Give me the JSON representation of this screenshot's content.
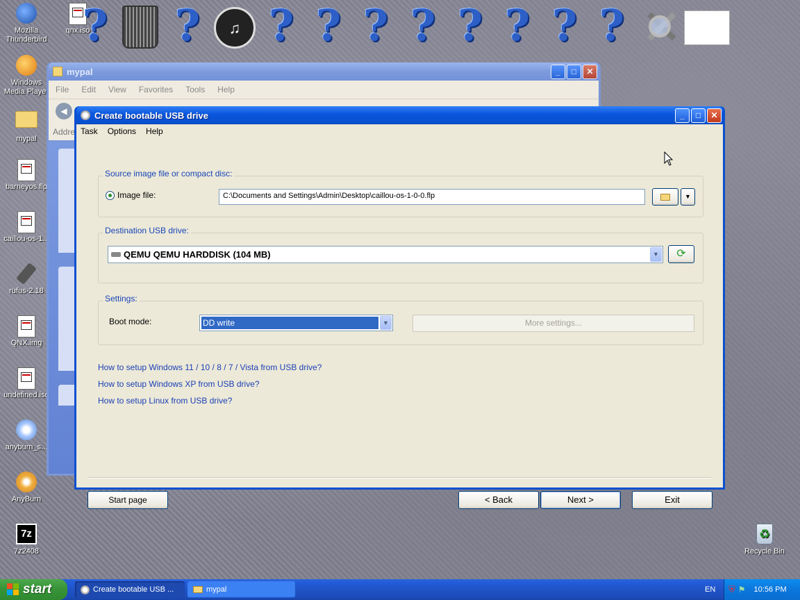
{
  "desktop": {
    "left_icons": [
      {
        "label": "Mozilla Thunderbird",
        "icon": "thunderbird-icon"
      },
      {
        "label": "Windows Media Player",
        "icon": "media-player-icon"
      },
      {
        "label": "mypal",
        "icon": "folder-icon"
      },
      {
        "label": "barneyos.flp",
        "icon": "disk-image-icon"
      },
      {
        "label": "caillou-os-1...",
        "icon": "disk-image-icon"
      },
      {
        "label": "rufus-2.18",
        "icon": "usb-icon"
      },
      {
        "label": "QNX.img",
        "icon": "disk-image-icon"
      },
      {
        "label": "undefined.iso",
        "icon": "disk-image-icon"
      },
      {
        "label": "anyburn_s...",
        "icon": "installer-icon"
      },
      {
        "label": "AnyBurn",
        "icon": "anyburn-icon"
      },
      {
        "label": "7z2408",
        "icon": "7zip-icon"
      }
    ],
    "second_col": [
      {
        "label": "qnx.iso",
        "icon": "disk-image-icon"
      }
    ],
    "recycle_bin": "Recycle Bin",
    "question_mark": "?"
  },
  "mypal_window": {
    "title": "mypal",
    "menu": [
      "File",
      "Edit",
      "View",
      "Favorites",
      "Tools",
      "Help"
    ],
    "address_label": "Addres"
  },
  "main_window": {
    "title": "Create bootable USB drive",
    "menu": [
      "Task",
      "Options",
      "Help"
    ],
    "source": {
      "group_label": "Source image file or compact disc:",
      "radio_label": "Image file:",
      "path": "C:\\Documents and Settings\\Admin\\Desktop\\caillou-os-1-0-0.flp"
    },
    "destination": {
      "group_label": "Destination USB drive:",
      "drive": "QEMU QEMU HARDDISK (104 MB)"
    },
    "settings": {
      "group_label": "Settings:",
      "boot_mode_label": "Boot mode:",
      "boot_mode_value": "DD write",
      "more_settings": "More settings..."
    },
    "links": [
      "How to setup Windows 11 / 10 / 8 / 7 / Vista from USB drive?",
      "How to setup Windows XP from USB drive?",
      "How to setup Linux from USB drive?"
    ],
    "buttons": {
      "start_page": "Start page",
      "back": "< Back",
      "next": "Next >",
      "exit": "Exit"
    }
  },
  "taskbar": {
    "start_label": "start",
    "tasks": [
      {
        "label": "Create bootable USB ...",
        "active": true
      },
      {
        "label": "mypal",
        "active": false
      }
    ],
    "language": "EN",
    "clock": "10:56 PM"
  },
  "colors": {
    "title_blue": "#0a55dc",
    "dialog_bg": "#ece9d8",
    "link_blue": "#1b3fb5",
    "start_green": "#389438"
  }
}
